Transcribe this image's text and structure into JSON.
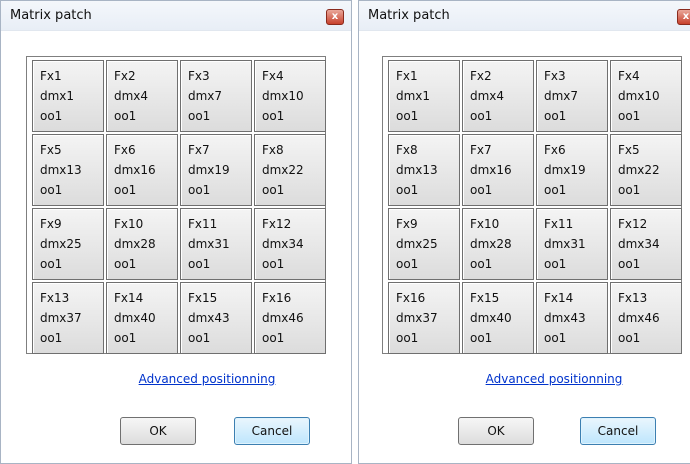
{
  "dialogs": [
    {
      "title": "Matrix patch",
      "close_glyph": "x",
      "cells": [
        {
          "fx": "Fx1",
          "dmx": "dmx1",
          "oo": "oo1"
        },
        {
          "fx": "Fx2",
          "dmx": "dmx4",
          "oo": "oo1"
        },
        {
          "fx": "Fx3",
          "dmx": "dmx7",
          "oo": "oo1"
        },
        {
          "fx": "Fx4",
          "dmx": "dmx10",
          "oo": "oo1"
        },
        {
          "fx": "Fx5",
          "dmx": "dmx13",
          "oo": "oo1"
        },
        {
          "fx": "Fx6",
          "dmx": "dmx16",
          "oo": "oo1"
        },
        {
          "fx": "Fx7",
          "dmx": "dmx19",
          "oo": "oo1"
        },
        {
          "fx": "Fx8",
          "dmx": "dmx22",
          "oo": "oo1"
        },
        {
          "fx": "Fx9",
          "dmx": "dmx25",
          "oo": "oo1"
        },
        {
          "fx": "Fx10",
          "dmx": "dmx28",
          "oo": "oo1"
        },
        {
          "fx": "Fx11",
          "dmx": "dmx31",
          "oo": "oo1"
        },
        {
          "fx": "Fx12",
          "dmx": "dmx34",
          "oo": "oo1"
        },
        {
          "fx": "Fx13",
          "dmx": "dmx37",
          "oo": "oo1"
        },
        {
          "fx": "Fx14",
          "dmx": "dmx40",
          "oo": "oo1"
        },
        {
          "fx": "Fx15",
          "dmx": "dmx43",
          "oo": "oo1"
        },
        {
          "fx": "Fx16",
          "dmx": "dmx46",
          "oo": "oo1"
        }
      ],
      "link": "Advanced positionning",
      "ok": "OK",
      "cancel": "Cancel"
    },
    {
      "title": "Matrix patch",
      "close_glyph": "x",
      "cells": [
        {
          "fx": "Fx1",
          "dmx": "dmx1",
          "oo": "oo1"
        },
        {
          "fx": "Fx2",
          "dmx": "dmx4",
          "oo": "oo1"
        },
        {
          "fx": "Fx3",
          "dmx": "dmx7",
          "oo": "oo1"
        },
        {
          "fx": "Fx4",
          "dmx": "dmx10",
          "oo": "oo1"
        },
        {
          "fx": "Fx8",
          "dmx": "dmx13",
          "oo": "oo1"
        },
        {
          "fx": "Fx7",
          "dmx": "dmx16",
          "oo": "oo1"
        },
        {
          "fx": "Fx6",
          "dmx": "dmx19",
          "oo": "oo1"
        },
        {
          "fx": "Fx5",
          "dmx": "dmx22",
          "oo": "oo1"
        },
        {
          "fx": "Fx9",
          "dmx": "dmx25",
          "oo": "oo1"
        },
        {
          "fx": "Fx10",
          "dmx": "dmx28",
          "oo": "oo1"
        },
        {
          "fx": "Fx11",
          "dmx": "dmx31",
          "oo": "oo1"
        },
        {
          "fx": "Fx12",
          "dmx": "dmx34",
          "oo": "oo1"
        },
        {
          "fx": "Fx16",
          "dmx": "dmx37",
          "oo": "oo1"
        },
        {
          "fx": "Fx15",
          "dmx": "dmx40",
          "oo": "oo1"
        },
        {
          "fx": "Fx14",
          "dmx": "dmx43",
          "oo": "oo1"
        },
        {
          "fx": "Fx13",
          "dmx": "dmx46",
          "oo": "oo1"
        }
      ],
      "link": "Advanced positionning",
      "ok": "OK",
      "cancel": "Cancel"
    }
  ],
  "colors": {
    "link": "#0033cc",
    "close_button": "#c8412c",
    "cancel_focus": "#3c7fb1"
  }
}
